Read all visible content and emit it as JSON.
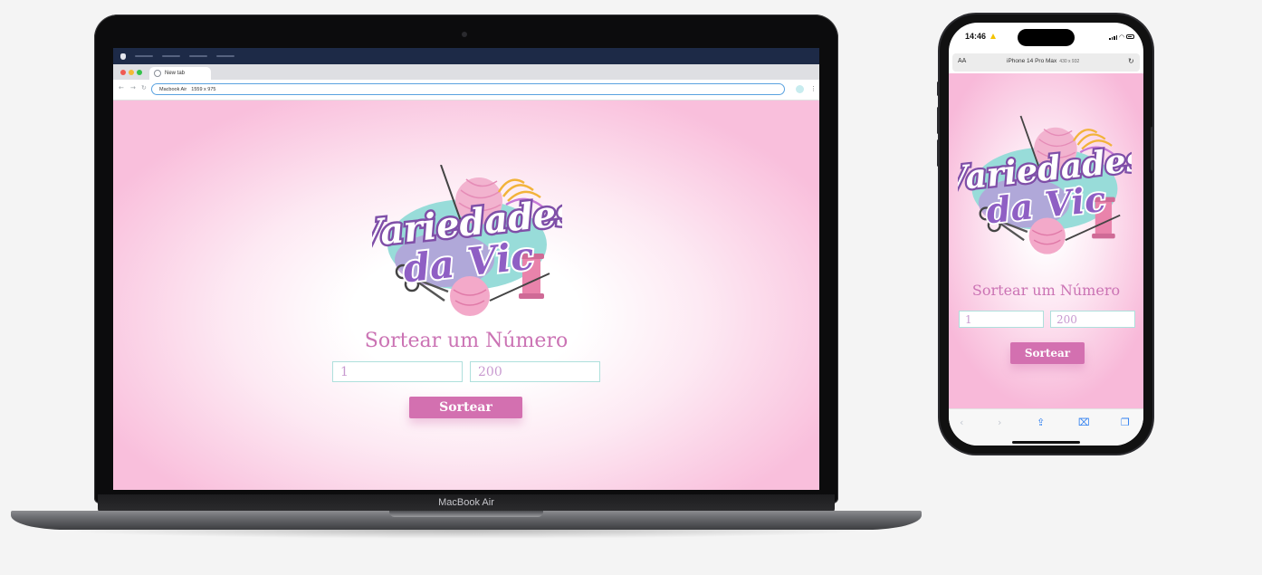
{
  "laptop": {
    "browser": {
      "tab_title": "New tab",
      "address_device": "Macbook Air",
      "address_dims": "1559 x 975"
    },
    "device_label": "MacBook Air",
    "page": {
      "logo_line1": "Variedades",
      "logo_line2": "da Vic",
      "title": "Sortear um Número",
      "min_value": "1",
      "max_value": "200",
      "button_label": "Sortear"
    }
  },
  "phone": {
    "status_time": "14:46",
    "url_aa": "AA",
    "url_device": "iPhone 14 Pro Max",
    "url_dims": "430 x 932",
    "page": {
      "logo_line1": "Variedades",
      "logo_line2": "da Vic",
      "title": "Sortear um Número",
      "min_value": "1",
      "max_value": "200",
      "button_label": "Sortear"
    },
    "toolbar_icons": [
      "back-icon",
      "forward-icon",
      "share-icon",
      "bookmarks-icon",
      "tabs-icon"
    ]
  },
  "colors": {
    "accent_pink": "#d370b0",
    "title_pink": "#cb73b4",
    "input_border": "#aee0dc",
    "logo_purple": "#7f4fa8",
    "logo_teal": "#98dcd9"
  }
}
